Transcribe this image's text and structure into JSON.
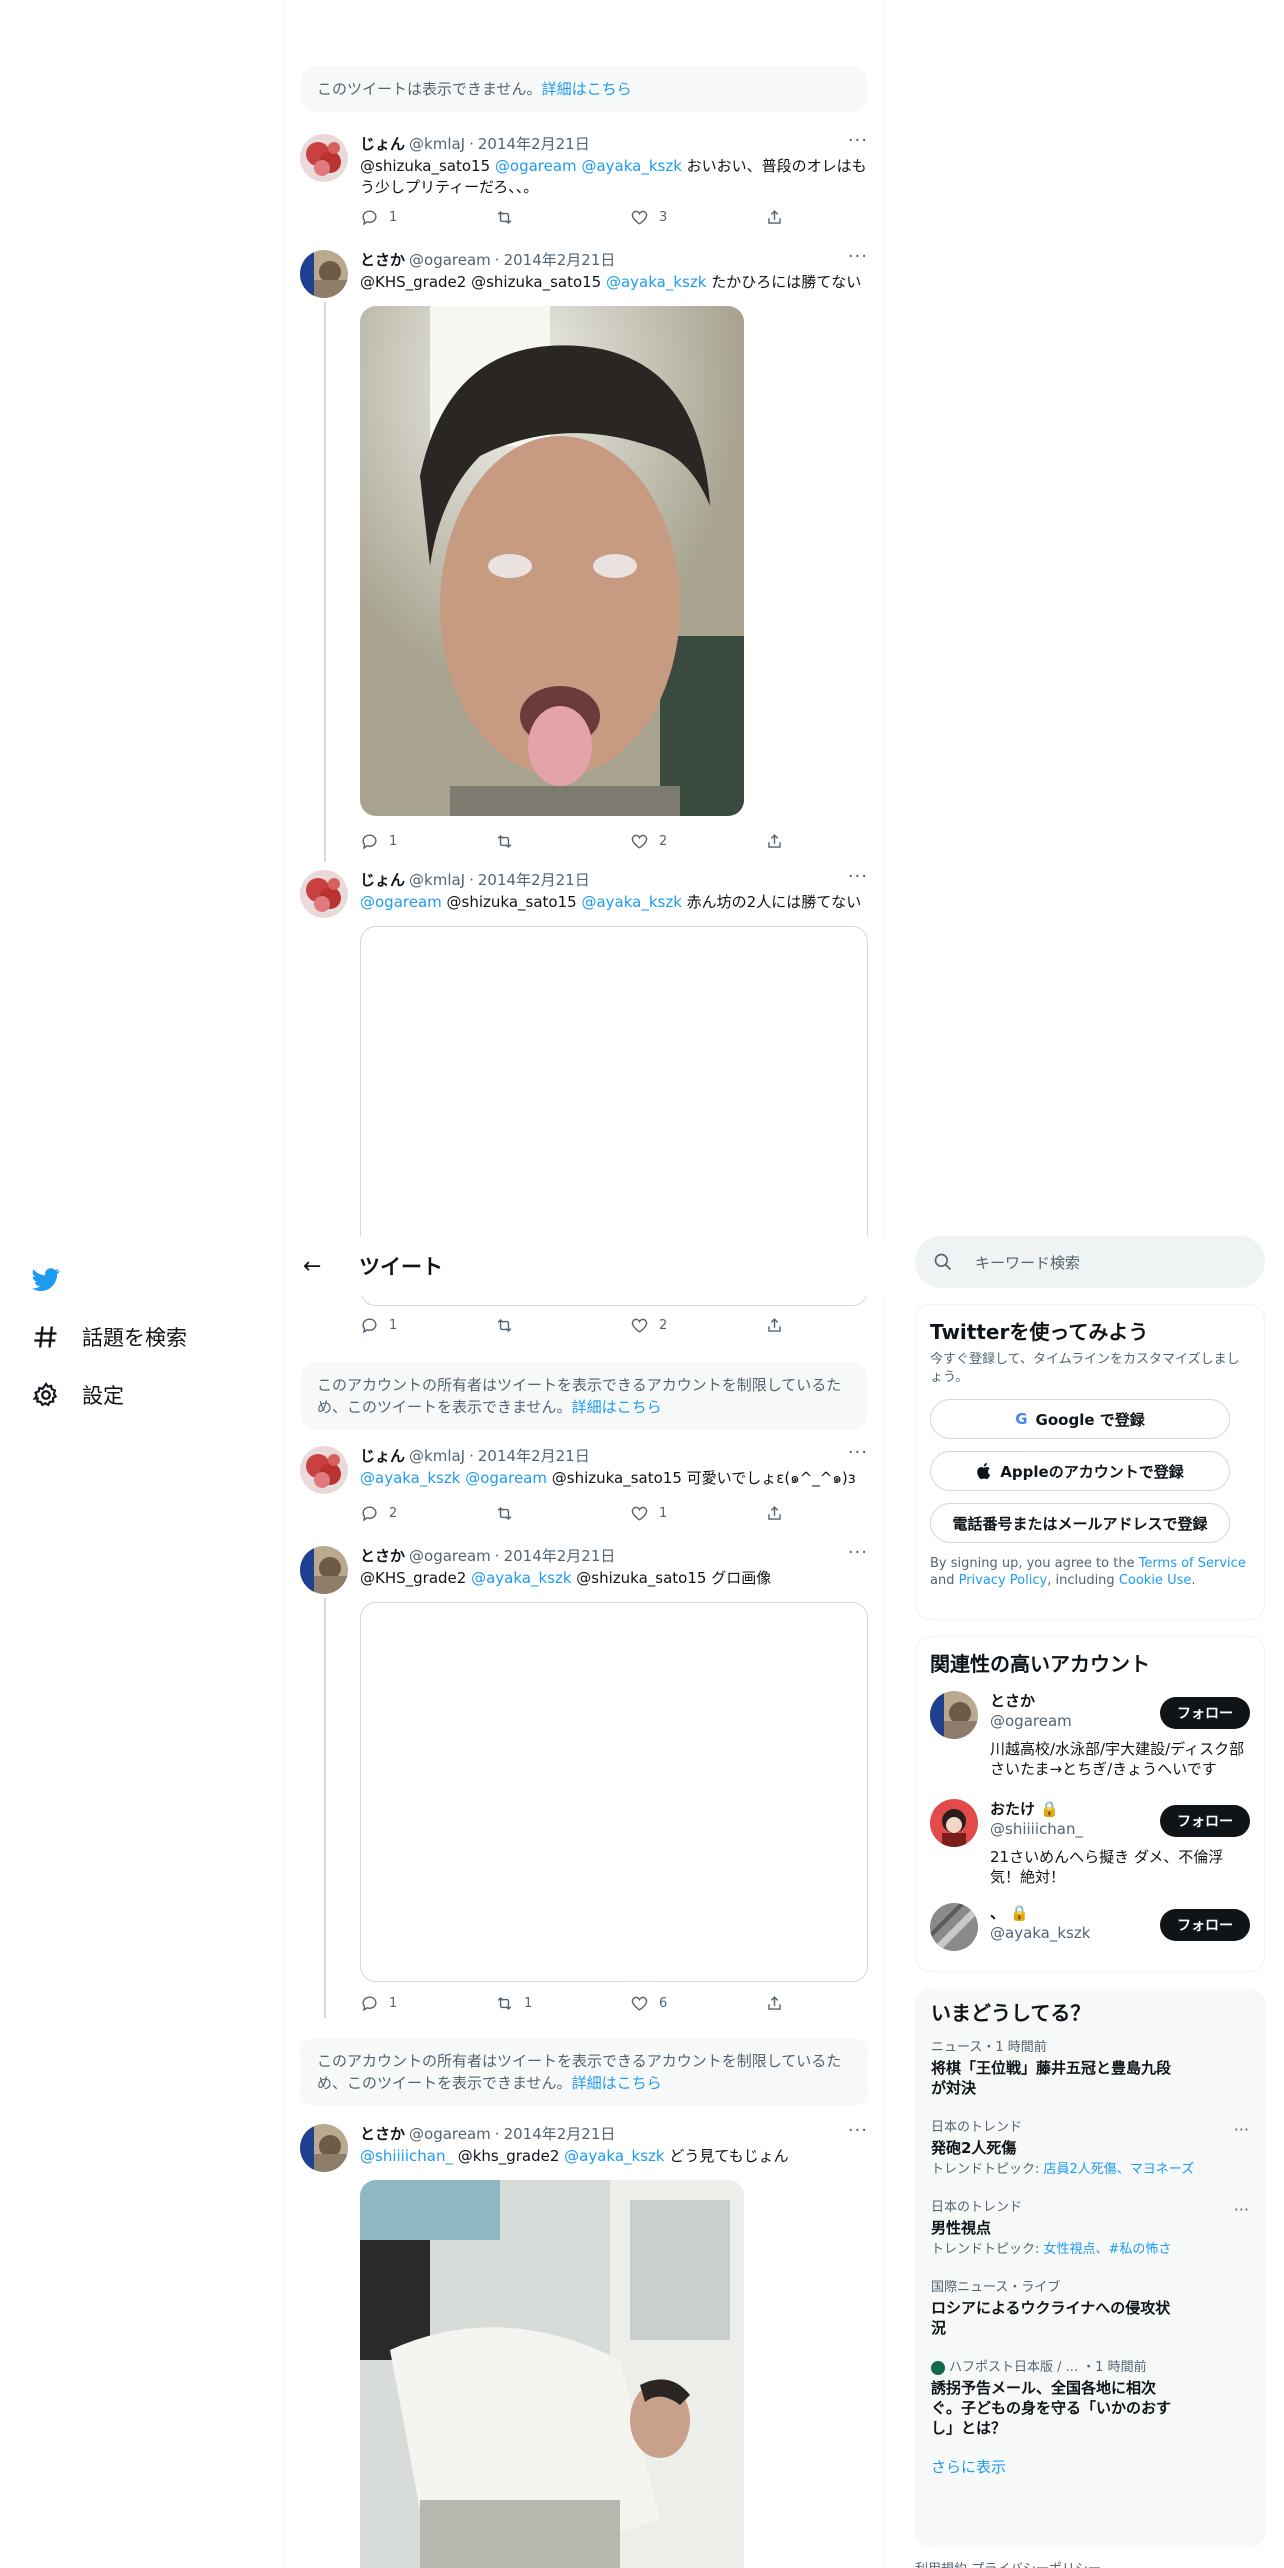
{
  "nav": {
    "explore_label": "話題を検索",
    "settings_label": "設定"
  },
  "header": {
    "title": "ツイート"
  },
  "notices": [
    {
      "text": "このツイートは表示できません。",
      "link": "詳細はこちら"
    },
    {
      "text": "このアカウントの所有者はツイートを表示できるアカウントを制限しているため、このツイートを表示できません。",
      "link": "詳細はこちら"
    },
    {
      "text": "このアカウントの所有者はツイートを表示できるアカウントを制限しているため、このツイートを表示できません。",
      "link": "詳細はこちら"
    }
  ],
  "tweets": [
    {
      "name": "じょん",
      "handle": "@kmlaJ",
      "date": "2014年2月21日",
      "text_parts": [
        "@shizuka_sato15 ",
        "@ogaream",
        " ",
        "@ayaka_kszk",
        " おいおい、普段のオレはもう少しプリティーだろ、、。"
      ],
      "reply": "1",
      "retweet": "",
      "like": "3"
    },
    {
      "name": "とさか",
      "handle": "@ogaream",
      "date": "2014年2月21日",
      "text_parts": [
        "@KHS_grade2 @shizuka_sato15 ",
        "@ayaka_kszk",
        " たかひろには勝てない"
      ],
      "reply": "1",
      "retweet": "",
      "like": "2"
    },
    {
      "name": "じょん",
      "handle": "@kmlaJ",
      "date": "2014年2月21日",
      "text_parts": [
        "@ogaream",
        " @shizuka_sato15 ",
        "@ayaka_kszk",
        " 赤ん坊の2人には勝てない"
      ],
      "reply": "1",
      "retweet": "",
      "like": "2"
    },
    {
      "name": "じょん",
      "handle": "@kmlaJ",
      "date": "2014年2月21日",
      "text_parts": [
        "@ayaka_kszk",
        " ",
        "@ogaream",
        " @shizuka_sato15 可愛いでしょε(๑^_^๑)з"
      ],
      "reply": "2",
      "retweet": "",
      "like": "1"
    },
    {
      "name": "とさか",
      "handle": "@ogaream",
      "date": "2014年2月21日",
      "text_parts": [
        "@KHS_grade2 ",
        "@ayaka_kszk",
        " @shizuka_sato15 グロ画像"
      ],
      "reply": "1",
      "retweet": "1",
      "like": "6"
    },
    {
      "name": "とさか",
      "handle": "@ogaream",
      "date": "2014年2月21日",
      "text_parts": [
        "@shiiiichan_",
        " @khs_grade2 ",
        "@ayaka_kszk",
        " どう見てもじょん"
      ],
      "reply": "",
      "retweet": "",
      "like": ""
    }
  ],
  "right": {
    "search_placeholder": "キーワード検索",
    "signup": {
      "title": "Twitterを使ってみよう",
      "sub": "今すぐ登録して、タイムラインをカスタマイズしましょう。",
      "google": "Google で登録",
      "apple": "Appleのアカウントで登録",
      "phone": "電話番号またはメールアドレスで登録",
      "fine_1": "By signing up, you agree to the ",
      "tos": "Terms of Service",
      "fine_2": " and ",
      "privacy": "Privacy Policy",
      "fine_3": ", including ",
      "cookie": "Cookie Use",
      "fine_4": "."
    },
    "accounts": {
      "title": "関連性の高いアカウント",
      "follow": "フォロー",
      "items": [
        {
          "name": "とさか",
          "handle": "@ogaream",
          "bio": "川越高校/水泳部/宇大建設/ディスク部 さいたま→とちぎ/きょうへいです"
        },
        {
          "name": "おたけ",
          "handle": "@shiiiichan_",
          "bio": "21さいめんへら擬き ダメ、不倫浮気！絶対！"
        },
        {
          "name": "、",
          "handle": "@ayaka_kszk",
          "bio": ""
        }
      ]
    },
    "trends": {
      "title": "いまどうしてる？",
      "items": [
        {
          "cat": "ニュース・1 時間前",
          "title": "将棋「王位戦」藤井五冠と豊島九段が対決",
          "topic_label": "",
          "topics": ""
        },
        {
          "cat": "日本のトレンド",
          "title": "発砲2人死傷",
          "topic_label": "トレンドトピック: ",
          "topics": "店員2人死傷、マヨネーズ"
        },
        {
          "cat": "日本のトレンド",
          "title": "男性視点",
          "topic_label": "トレンドトピック: ",
          "topics": "女性視点、#私の怖さ"
        },
        {
          "cat": "国際ニュース・ライブ",
          "title": "ロシアによるウクライナへの侵攻状況",
          "topic_label": "",
          "topics": ""
        },
        {
          "cat": "ハフポスト日本版 / ... ・1 時間前",
          "title": "誘拐予告メール、全国各地に相次ぐ。子どもの身を守る「いかのおすし」とは？",
          "topic_label": "",
          "topics": ""
        }
      ],
      "show_more": "さらに表示"
    },
    "footer": "利用規約  プライバシーポリシー"
  }
}
